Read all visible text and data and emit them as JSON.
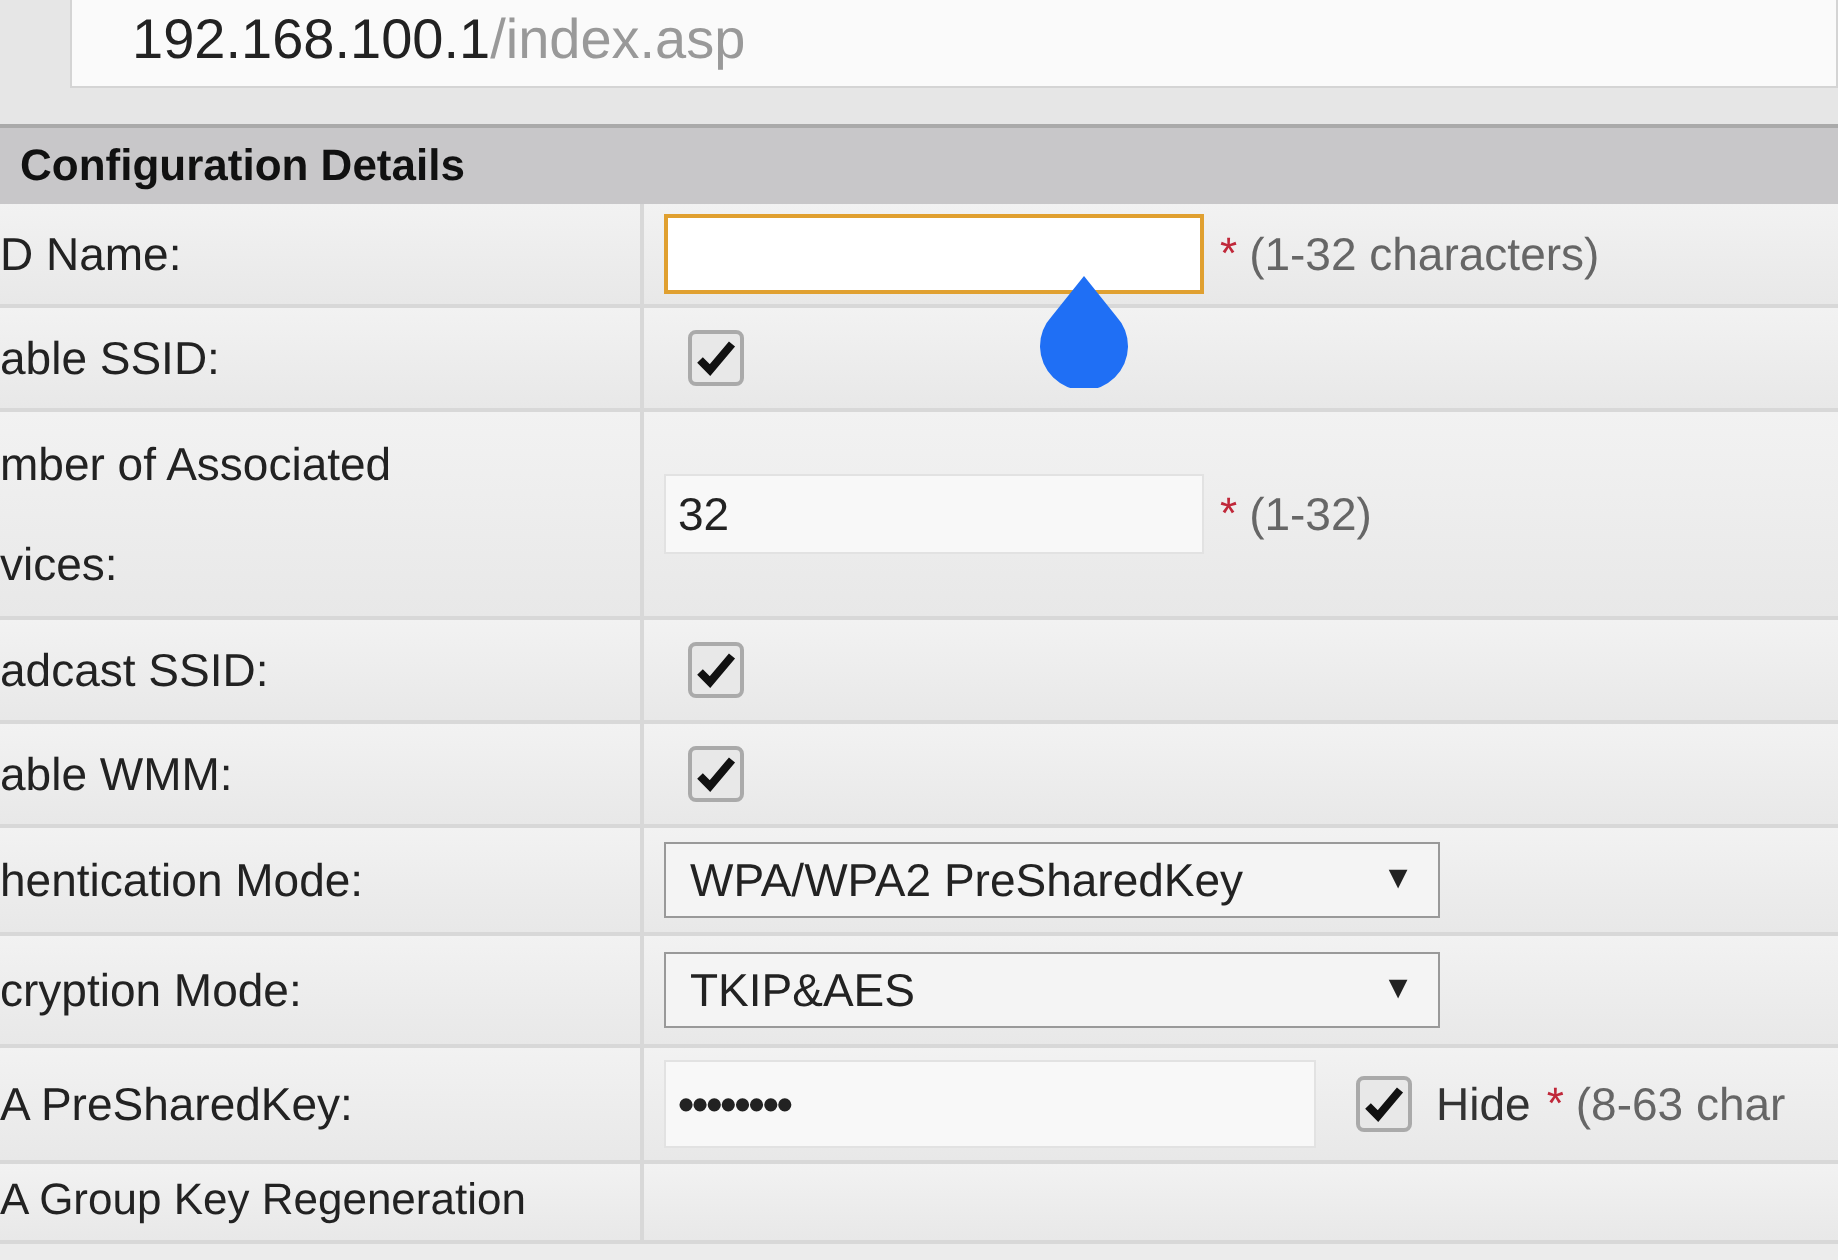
{
  "address_bar": {
    "host": "192.168.100.1",
    "path": "/index.asp"
  },
  "section": {
    "title": "Configuration Details"
  },
  "rows": [
    {
      "kind": "text",
      "label": "D Name:",
      "focused": true,
      "hint": "(1-32 characters)",
      "required_mark": "*"
    },
    {
      "kind": "checkbox",
      "label": "able SSID:",
      "checked": true
    },
    {
      "kind": "text",
      "label": "mber of Associated vices:",
      "value": "32",
      "focused": false,
      "hint": "(1-32)",
      "required_mark": "*"
    },
    {
      "kind": "checkbox",
      "label": "adcast SSID:",
      "checked": true
    },
    {
      "kind": "checkbox",
      "label": "able WMM:",
      "checked": true
    },
    {
      "kind": "select",
      "label": "hentication Mode:",
      "value": "WPA/WPA2 PreSharedKey",
      "arrow": "▼"
    },
    {
      "kind": "select",
      "label": "cryption Mode:",
      "value": "TKIP&AES",
      "arrow": "▼"
    },
    {
      "kind": "password",
      "label": "A PreSharedKey:",
      "value": "••••••••",
      "hide_checked": true,
      "hide_label": "Hide",
      "hint": "(8-63 char",
      "required_mark": "*"
    },
    {
      "kind": "empty",
      "label": "A Group Key Regeneration"
    }
  ]
}
